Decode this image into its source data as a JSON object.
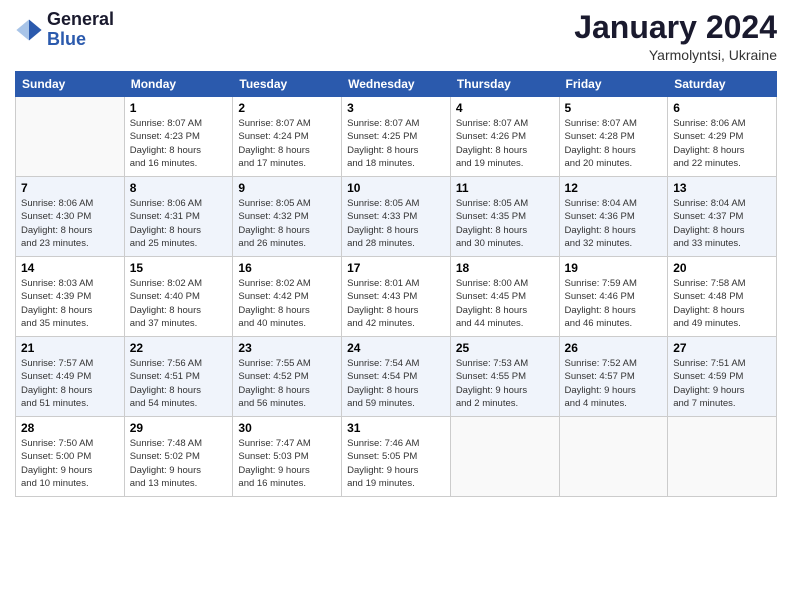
{
  "header": {
    "logo_line1": "General",
    "logo_line2": "Blue",
    "month": "January 2024",
    "location": "Yarmolyntsi, Ukraine"
  },
  "weekdays": [
    "Sunday",
    "Monday",
    "Tuesday",
    "Wednesday",
    "Thursday",
    "Friday",
    "Saturday"
  ],
  "weeks": [
    [
      {
        "day": "",
        "info": ""
      },
      {
        "day": "1",
        "info": "Sunrise: 8:07 AM\nSunset: 4:23 PM\nDaylight: 8 hours\nand 16 minutes."
      },
      {
        "day": "2",
        "info": "Sunrise: 8:07 AM\nSunset: 4:24 PM\nDaylight: 8 hours\nand 17 minutes."
      },
      {
        "day": "3",
        "info": "Sunrise: 8:07 AM\nSunset: 4:25 PM\nDaylight: 8 hours\nand 18 minutes."
      },
      {
        "day": "4",
        "info": "Sunrise: 8:07 AM\nSunset: 4:26 PM\nDaylight: 8 hours\nand 19 minutes."
      },
      {
        "day": "5",
        "info": "Sunrise: 8:07 AM\nSunset: 4:28 PM\nDaylight: 8 hours\nand 20 minutes."
      },
      {
        "day": "6",
        "info": "Sunrise: 8:06 AM\nSunset: 4:29 PM\nDaylight: 8 hours\nand 22 minutes."
      }
    ],
    [
      {
        "day": "7",
        "info": "Sunrise: 8:06 AM\nSunset: 4:30 PM\nDaylight: 8 hours\nand 23 minutes."
      },
      {
        "day": "8",
        "info": "Sunrise: 8:06 AM\nSunset: 4:31 PM\nDaylight: 8 hours\nand 25 minutes."
      },
      {
        "day": "9",
        "info": "Sunrise: 8:05 AM\nSunset: 4:32 PM\nDaylight: 8 hours\nand 26 minutes."
      },
      {
        "day": "10",
        "info": "Sunrise: 8:05 AM\nSunset: 4:33 PM\nDaylight: 8 hours\nand 28 minutes."
      },
      {
        "day": "11",
        "info": "Sunrise: 8:05 AM\nSunset: 4:35 PM\nDaylight: 8 hours\nand 30 minutes."
      },
      {
        "day": "12",
        "info": "Sunrise: 8:04 AM\nSunset: 4:36 PM\nDaylight: 8 hours\nand 32 minutes."
      },
      {
        "day": "13",
        "info": "Sunrise: 8:04 AM\nSunset: 4:37 PM\nDaylight: 8 hours\nand 33 minutes."
      }
    ],
    [
      {
        "day": "14",
        "info": "Sunrise: 8:03 AM\nSunset: 4:39 PM\nDaylight: 8 hours\nand 35 minutes."
      },
      {
        "day": "15",
        "info": "Sunrise: 8:02 AM\nSunset: 4:40 PM\nDaylight: 8 hours\nand 37 minutes."
      },
      {
        "day": "16",
        "info": "Sunrise: 8:02 AM\nSunset: 4:42 PM\nDaylight: 8 hours\nand 40 minutes."
      },
      {
        "day": "17",
        "info": "Sunrise: 8:01 AM\nSunset: 4:43 PM\nDaylight: 8 hours\nand 42 minutes."
      },
      {
        "day": "18",
        "info": "Sunrise: 8:00 AM\nSunset: 4:45 PM\nDaylight: 8 hours\nand 44 minutes."
      },
      {
        "day": "19",
        "info": "Sunrise: 7:59 AM\nSunset: 4:46 PM\nDaylight: 8 hours\nand 46 minutes."
      },
      {
        "day": "20",
        "info": "Sunrise: 7:58 AM\nSunset: 4:48 PM\nDaylight: 8 hours\nand 49 minutes."
      }
    ],
    [
      {
        "day": "21",
        "info": "Sunrise: 7:57 AM\nSunset: 4:49 PM\nDaylight: 8 hours\nand 51 minutes."
      },
      {
        "day": "22",
        "info": "Sunrise: 7:56 AM\nSunset: 4:51 PM\nDaylight: 8 hours\nand 54 minutes."
      },
      {
        "day": "23",
        "info": "Sunrise: 7:55 AM\nSunset: 4:52 PM\nDaylight: 8 hours\nand 56 minutes."
      },
      {
        "day": "24",
        "info": "Sunrise: 7:54 AM\nSunset: 4:54 PM\nDaylight: 8 hours\nand 59 minutes."
      },
      {
        "day": "25",
        "info": "Sunrise: 7:53 AM\nSunset: 4:55 PM\nDaylight: 9 hours\nand 2 minutes."
      },
      {
        "day": "26",
        "info": "Sunrise: 7:52 AM\nSunset: 4:57 PM\nDaylight: 9 hours\nand 4 minutes."
      },
      {
        "day": "27",
        "info": "Sunrise: 7:51 AM\nSunset: 4:59 PM\nDaylight: 9 hours\nand 7 minutes."
      }
    ],
    [
      {
        "day": "28",
        "info": "Sunrise: 7:50 AM\nSunset: 5:00 PM\nDaylight: 9 hours\nand 10 minutes."
      },
      {
        "day": "29",
        "info": "Sunrise: 7:48 AM\nSunset: 5:02 PM\nDaylight: 9 hours\nand 13 minutes."
      },
      {
        "day": "30",
        "info": "Sunrise: 7:47 AM\nSunset: 5:03 PM\nDaylight: 9 hours\nand 16 minutes."
      },
      {
        "day": "31",
        "info": "Sunrise: 7:46 AM\nSunset: 5:05 PM\nDaylight: 9 hours\nand 19 minutes."
      },
      {
        "day": "",
        "info": ""
      },
      {
        "day": "",
        "info": ""
      },
      {
        "day": "",
        "info": ""
      }
    ]
  ]
}
